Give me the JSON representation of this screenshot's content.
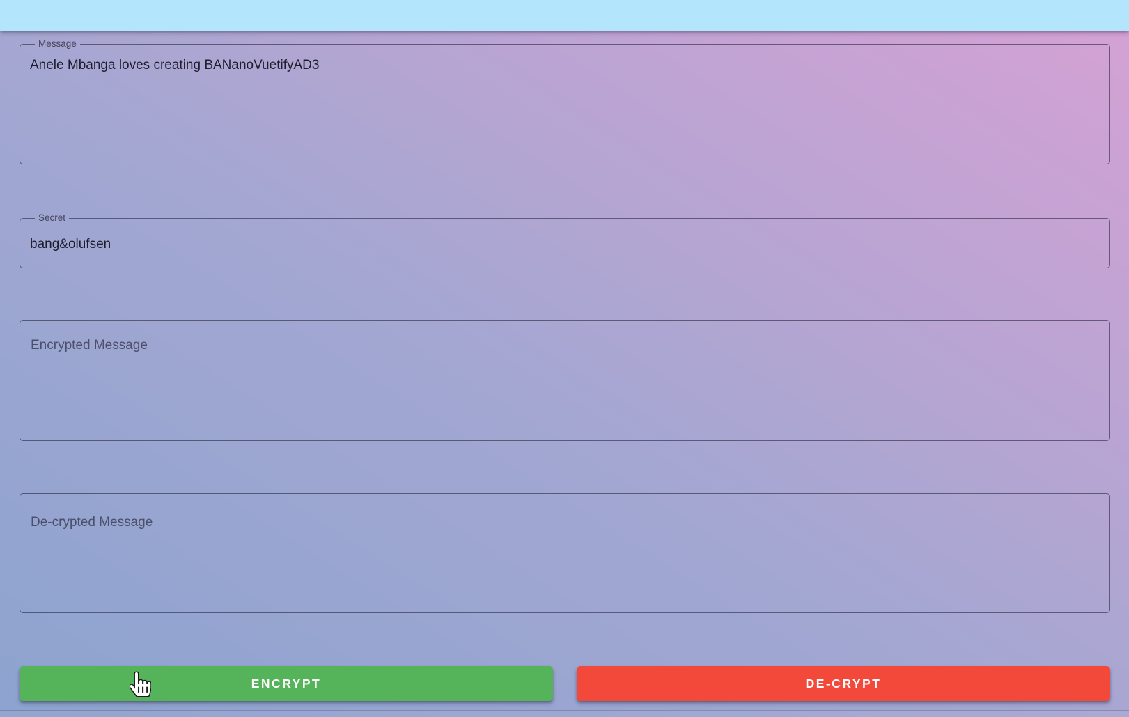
{
  "app": {
    "appbar_color": "#b3e5fc",
    "background": {
      "gradient_bottom_left": "#8da3cf",
      "gradient_top_right": "#d6a1d4"
    }
  },
  "fields": {
    "message": {
      "label": "Message",
      "value": "Anele Mbanga loves creating BANanoVuetifyAD3"
    },
    "secret": {
      "label": "Secret",
      "value": "bang&olufsen"
    },
    "encrypted": {
      "placeholder": "Encrypted Message",
      "value": ""
    },
    "decrypted": {
      "placeholder": "De-crypted Message",
      "value": ""
    }
  },
  "buttons": {
    "encrypt": {
      "label": "ENCRYPT",
      "color": "#55b45a"
    },
    "decrypt": {
      "label": "DE-CRYPT",
      "color": "#f3493b"
    }
  },
  "cursor": {
    "icon": "hand-pointer-cursor"
  }
}
